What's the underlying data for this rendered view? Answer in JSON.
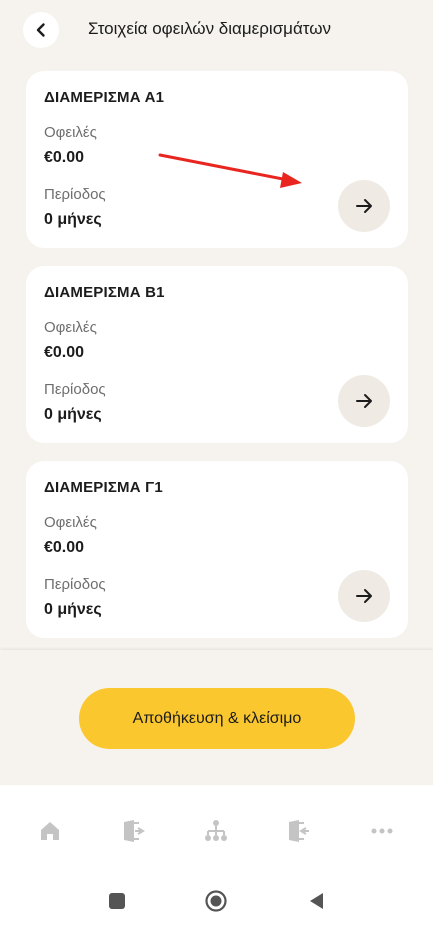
{
  "header": {
    "title": "Στοιχεία οφειλών διαμερισμάτων",
    "back_icon": "chevron-left-icon"
  },
  "field_labels": {
    "debts": "Οφειλές",
    "period": "Περίοδος"
  },
  "apartments": [
    {
      "name": "ΔΙΑΜΕΡΙΣΜΑ Α1",
      "debt": "€0.00",
      "period": "0 μήνες"
    },
    {
      "name": "ΔΙΑΜΕΡΙΣΜΑ Β1",
      "debt": "€0.00",
      "period": "0 μήνες"
    },
    {
      "name": "ΔΙΑΜΕΡΙΣΜΑ Γ1",
      "debt": "€0.00",
      "period": "0 μήνες"
    }
  ],
  "actions": {
    "save_label": "Αποθήκευση & κλείσιμο"
  },
  "tabbar": {
    "icons": [
      "home-icon",
      "door-enter-icon",
      "hierarchy-icon",
      "door-exit-icon",
      "more-icon"
    ]
  },
  "colors": {
    "background": "#f6f3ee",
    "card": "#ffffff",
    "accent": "#fbc72f",
    "annotation_arrow": "#e8261f"
  }
}
